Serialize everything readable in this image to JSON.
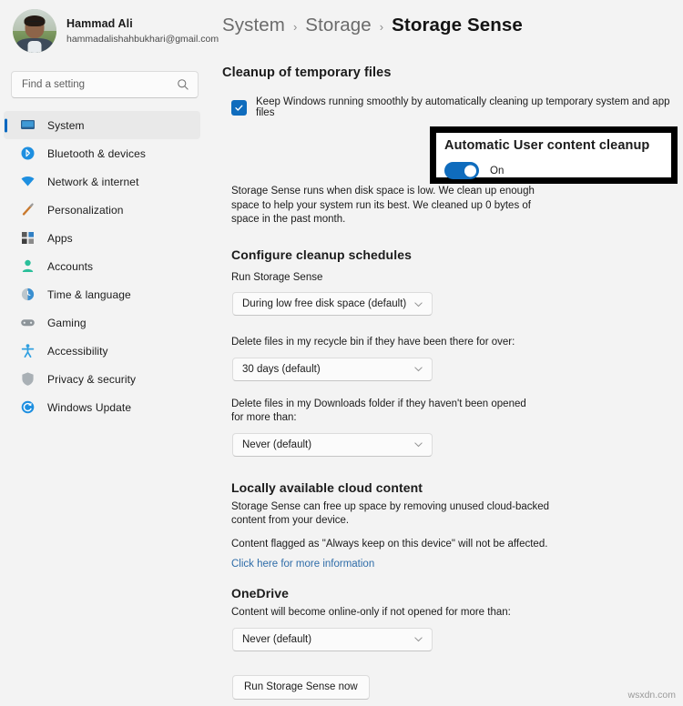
{
  "account": {
    "name": "Hammad Ali",
    "email": "hammadalishahbukhari@gmail.com",
    "avatar_icon": "user-photo-avatar"
  },
  "search": {
    "placeholder": "Find a setting",
    "value": "",
    "icon": "search-icon"
  },
  "sidebar": {
    "items": [
      {
        "label": "System",
        "icon": "monitor-icon",
        "selected": true
      },
      {
        "label": "Bluetooth & devices",
        "icon": "bluetooth-icon",
        "selected": false
      },
      {
        "label": "Network & internet",
        "icon": "wifi-icon",
        "selected": false
      },
      {
        "label": "Personalization",
        "icon": "paintbrush-icon",
        "selected": false
      },
      {
        "label": "Apps",
        "icon": "apps-grid-icon",
        "selected": false
      },
      {
        "label": "Accounts",
        "icon": "person-icon",
        "selected": false
      },
      {
        "label": "Time & language",
        "icon": "clock-globe-icon",
        "selected": false
      },
      {
        "label": "Gaming",
        "icon": "gamepad-icon",
        "selected": false
      },
      {
        "label": "Accessibility",
        "icon": "accessibility-person-icon",
        "selected": false
      },
      {
        "label": "Privacy & security",
        "icon": "shield-icon",
        "selected": false
      },
      {
        "label": "Windows Update",
        "icon": "update-refresh-icon",
        "selected": false
      }
    ]
  },
  "breadcrumb": {
    "root": "System",
    "parent": "Storage",
    "current": "Storage Sense",
    "separator": "›"
  },
  "main": {
    "cleanup_heading": "Cleanup of temporary files",
    "cleanup_checkbox_label": "Keep Windows running smoothly by automatically cleaning up temporary system and app files",
    "cleanup_checkbox_checked": true,
    "auto_cleanup": {
      "heading": "Automatic User content cleanup",
      "toggle_state": "On",
      "toggle_on": true,
      "highlighted": true,
      "highlight_color": "#000000"
    },
    "storage_sense_description": "Storage Sense runs when disk space is low. We clean up enough space to help your system run its best. We cleaned up 0 bytes of space in the past month.",
    "schedules": {
      "heading": "Configure cleanup schedules",
      "run_label": "Run Storage Sense",
      "run_value": "During low free disk space (default)",
      "recycle_label": "Delete files in my recycle bin if they have been there for over:",
      "recycle_value": "30 days (default)",
      "downloads_label": "Delete files in my Downloads folder if they haven't been opened for more than:",
      "downloads_value": "Never (default)"
    },
    "cloud": {
      "heading": "Locally available cloud content",
      "description": "Storage Sense can free up space by removing unused cloud-backed content from your device.",
      "note": "Content flagged as \"Always keep on this device\" will not be affected.",
      "link": "Click here for more information",
      "link_color": "#2e6ca8"
    },
    "onedrive": {
      "heading": "OneDrive",
      "description": "Content will become online-only if not opened for more than:",
      "value": "Never (default)"
    },
    "run_now_button": "Run Storage Sense now"
  },
  "watermark": "wsxdn.com",
  "colors": {
    "accent": "#0f6cbd",
    "selection_bar": "#0067c0",
    "page_bg": "#f3f3f3"
  }
}
